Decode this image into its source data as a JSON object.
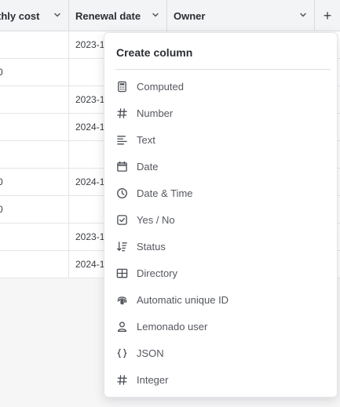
{
  "columns": {
    "cost": "thly cost",
    "renewal": "Renewal date",
    "owner": "Owner",
    "add": "+"
  },
  "rows": [
    {
      "cost": "",
      "renewal": "2023-1"
    },
    {
      "cost": "0",
      "renewal": ""
    },
    {
      "cost": "",
      "renewal": "2023-1"
    },
    {
      "cost": "",
      "renewal": "2024-1"
    },
    {
      "cost": "",
      "renewal": ""
    },
    {
      "cost": "0",
      "renewal": "2024-1"
    },
    {
      "cost": "0",
      "renewal": ""
    },
    {
      "cost": "",
      "renewal": "2023-1"
    },
    {
      "cost": "",
      "renewal": "2024-1"
    }
  ],
  "menu": {
    "title": "Create column",
    "items": [
      {
        "label": "Computed",
        "icon": "calculator-icon"
      },
      {
        "label": "Number",
        "icon": "hash-icon"
      },
      {
        "label": "Text",
        "icon": "text-align-icon"
      },
      {
        "label": "Date",
        "icon": "calendar-icon"
      },
      {
        "label": "Date & Time",
        "icon": "clock-icon"
      },
      {
        "label": "Yes / No",
        "icon": "checkbox-icon"
      },
      {
        "label": "Status",
        "icon": "sort-status-icon"
      },
      {
        "label": "Directory",
        "icon": "grid-table-icon"
      },
      {
        "label": "Automatic unique ID",
        "icon": "fingerprint-icon"
      },
      {
        "label": "Lemonado user",
        "icon": "user-icon"
      },
      {
        "label": "JSON",
        "icon": "braces-icon"
      },
      {
        "label": "Integer",
        "icon": "hash-icon"
      }
    ]
  }
}
